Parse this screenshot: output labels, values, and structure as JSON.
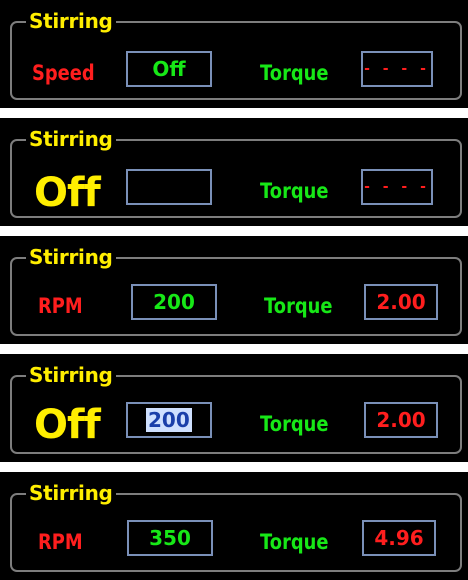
{
  "colors": {
    "panel_bg": "#000000",
    "frame_border": "#7d7d7d",
    "box_border": "#7a90b8",
    "legend": "#ffee00",
    "off_text": "#ffee00",
    "red": "#ff1e1e",
    "green": "#17e817",
    "selection_bg": "#cfe0ff"
  },
  "panels": [
    {
      "legend": "Stirring",
      "speed_label": "Speed",
      "speed_value": "Off",
      "torque_label": "Torque",
      "torque_value": "- - - -"
    },
    {
      "legend": "Stirring",
      "off_text": "Off",
      "speed_value": "",
      "torque_label": "Torque",
      "torque_value": "- - - -"
    },
    {
      "legend": "Stirring",
      "speed_label": "RPM",
      "speed_value": "200",
      "torque_label": "Torque",
      "torque_value": "2.00"
    },
    {
      "legend": "Stirring",
      "off_text": "Off",
      "speed_value": "200",
      "speed_value_selected": true,
      "torque_label": "Torque",
      "torque_value": "2.00"
    },
    {
      "legend": "Stirring",
      "speed_label": "RPM",
      "speed_value": "350",
      "torque_label": "Torque",
      "torque_value": "4.96"
    }
  ]
}
